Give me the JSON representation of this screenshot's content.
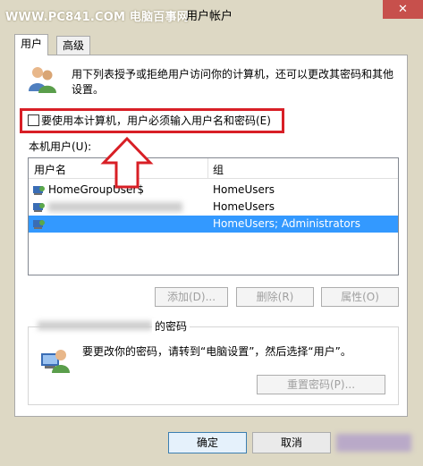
{
  "watermark": "WWW.PC841.COM 电脑百事网",
  "window": {
    "title": "用户帐户",
    "close": "✕"
  },
  "tabs": [
    {
      "label": "用户",
      "active": true
    },
    {
      "label": "高级",
      "active": false
    }
  ],
  "description": "用下列表授予或拒绝用户访问你的计算机，还可以更改其密码和其他设置。",
  "require_login": {
    "label": "要使用本计算机，用户必须输入用户名和密码(E)",
    "checked": false
  },
  "local_users": {
    "label": "本机用户(U):",
    "columns": [
      "用户名",
      "组"
    ],
    "rows": [
      {
        "name": "HomeGroupUser$",
        "group": "HomeUsers",
        "selected": false
      },
      {
        "name": "",
        "group": "HomeUsers",
        "selected": false
      },
      {
        "name": "",
        "group": "HomeUsers; Administrators",
        "selected": true
      }
    ]
  },
  "buttons": {
    "add": "添加(D)...",
    "remove": "删除(R)",
    "properties": "属性(O)"
  },
  "password_group": {
    "title": "的密码",
    "text": "要更改你的密码，请转到“电脑设置”，然后选择“用户”。",
    "reset": "重置密码(P)..."
  },
  "footer": {
    "ok": "确定",
    "cancel": "取消"
  },
  "colors": {
    "accent": "#3399ff",
    "highlight": "#d81f26",
    "frame": "#ddd8c4",
    "close": "#c7504c"
  }
}
